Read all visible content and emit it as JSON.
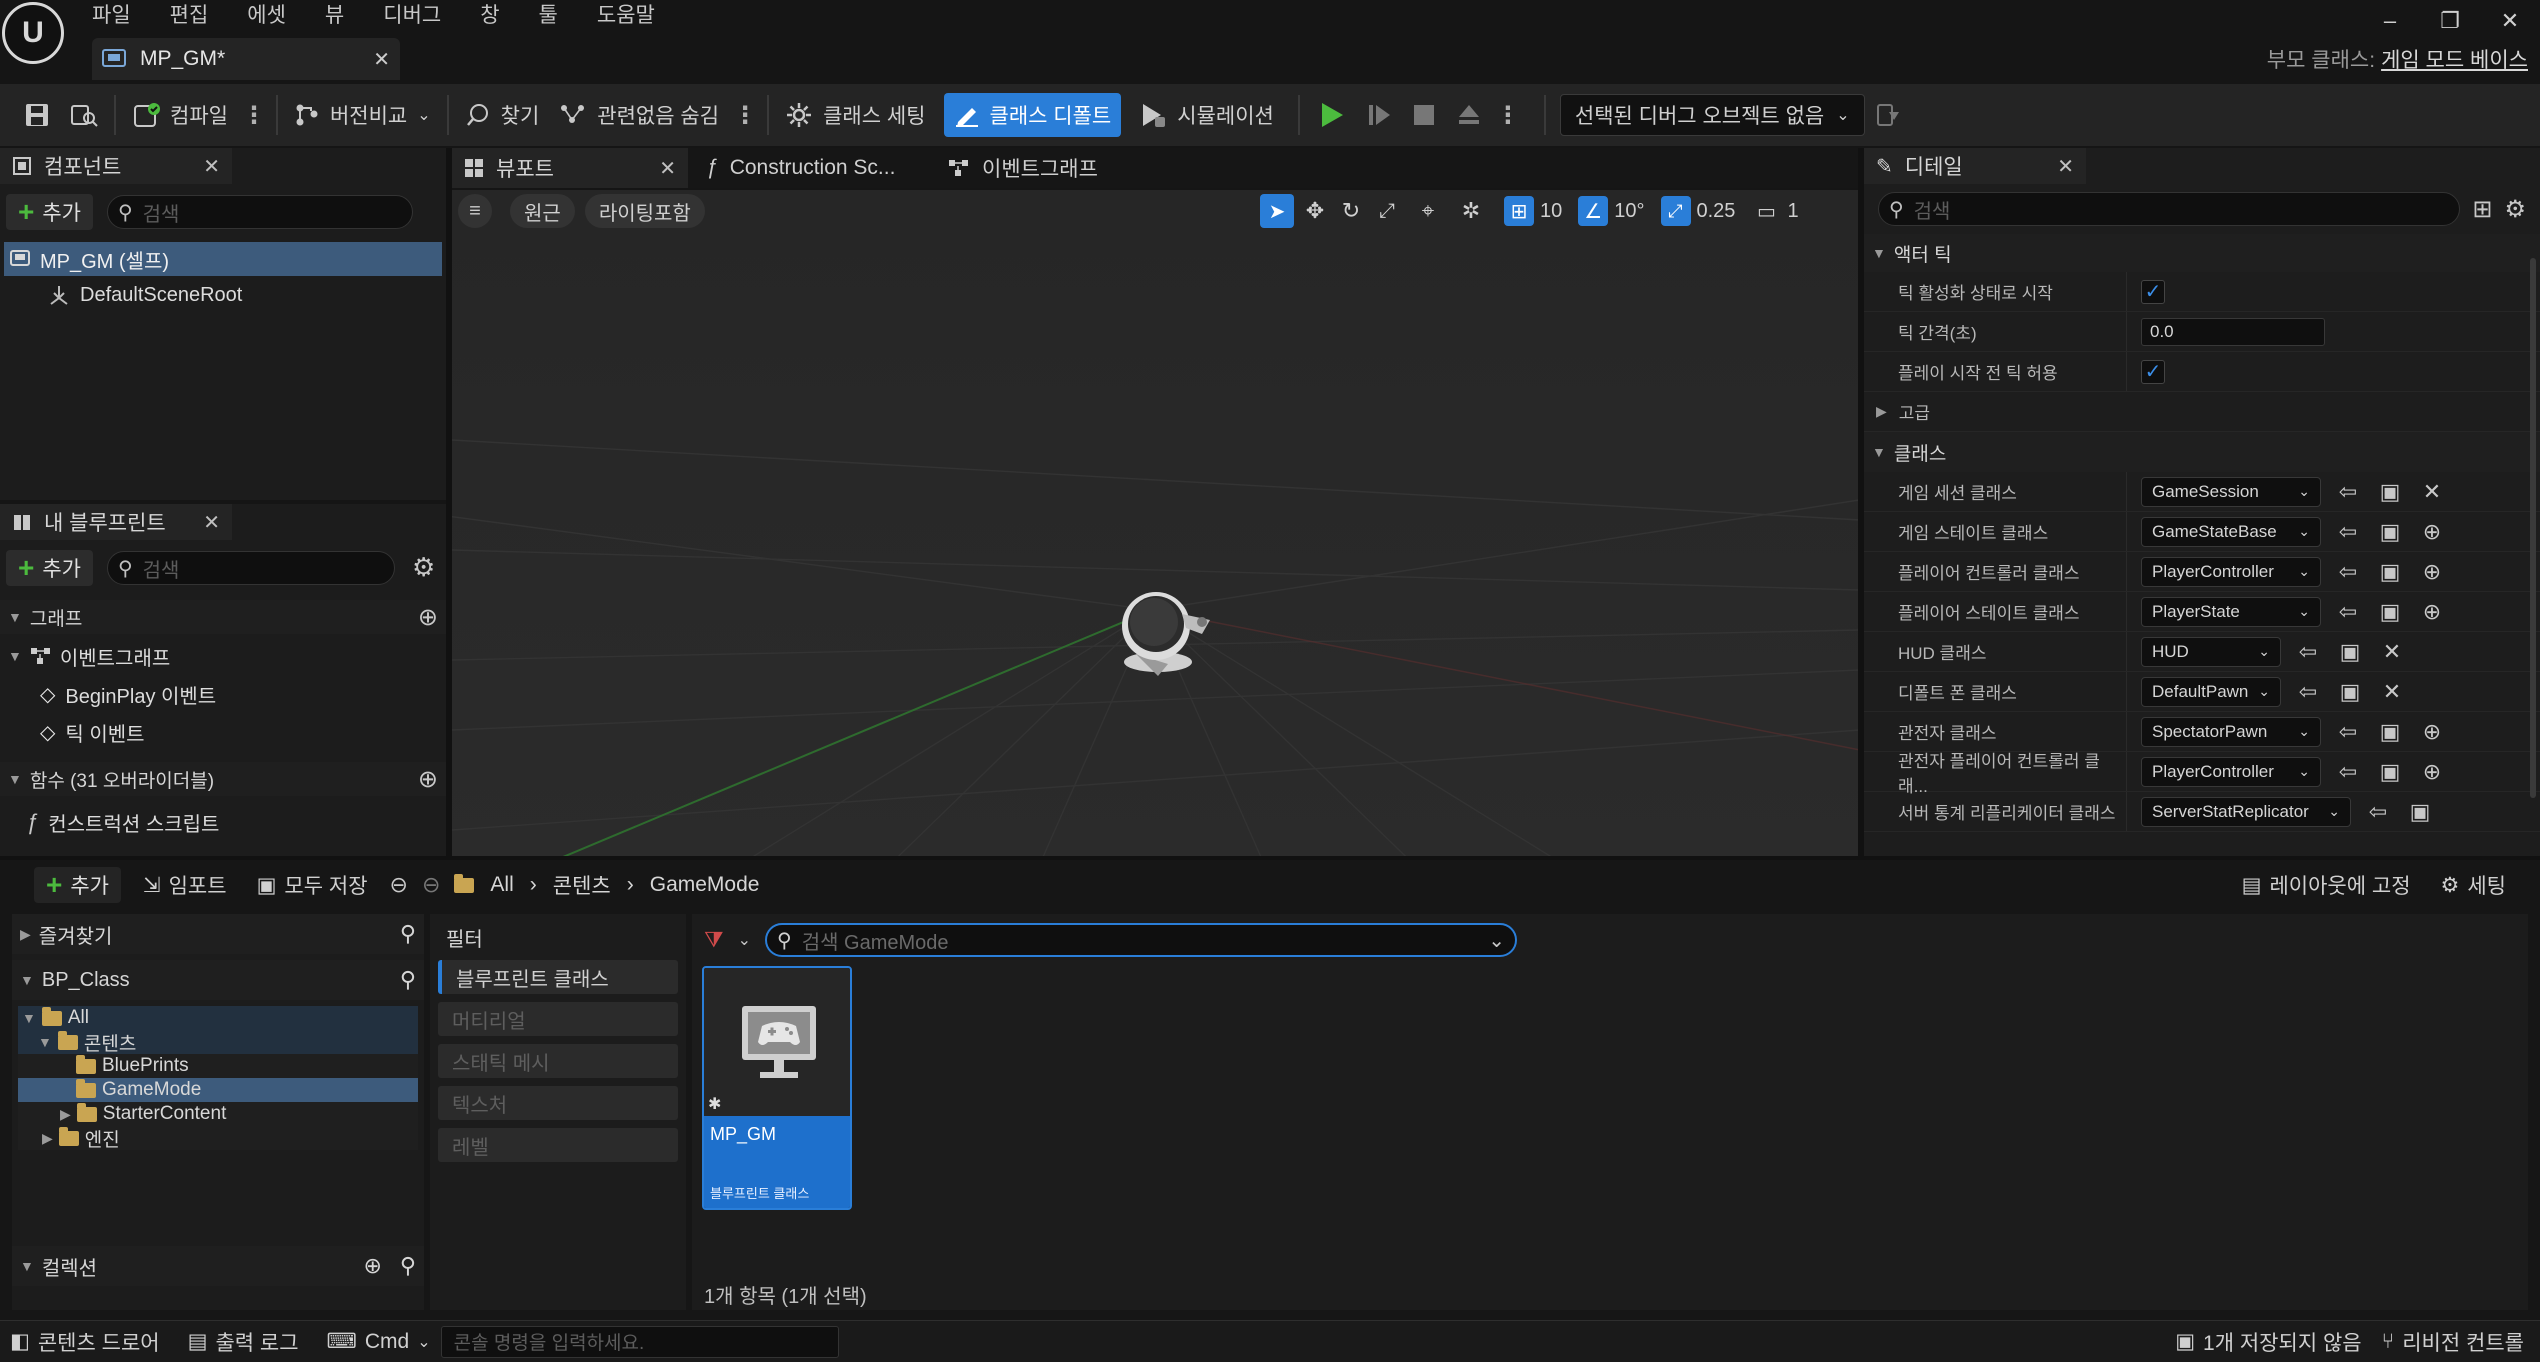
{
  "app": {
    "logo_text": "U",
    "menu": [
      "파일",
      "편집",
      "에셋",
      "뷰",
      "디버그",
      "창",
      "툴",
      "도움말"
    ],
    "doc_tab": "MP_GM*",
    "parent_class_label": "부모 클래스:",
    "parent_class_value": "게임 모드 베이스",
    "window_controls": [
      "–",
      "❐",
      "✕"
    ]
  },
  "toolbar": {
    "compile": "컴파일",
    "diff": "버전비교",
    "find": "찾기",
    "hide_unrelated": "관련없음 숨김",
    "class_settings": "클래스 세팅",
    "class_defaults": "클래스 디폴트",
    "simulation": "시뮬레이션",
    "debug_select": "선택된 디버그 오브젝트 없음"
  },
  "components": {
    "tab": "컴포넌트",
    "add": "추가",
    "search_placeholder": "검색",
    "items": [
      "MP_GM (셀프)",
      "DefaultSceneRoot"
    ]
  },
  "my_blueprint": {
    "tab": "내 블루프린트",
    "add": "추가",
    "search_placeholder": "검색",
    "graphs_header": "그래프",
    "event_graph": "이벤트그래프",
    "events": [
      "BeginPlay 이벤트",
      "틱 이벤트"
    ],
    "functions_header": "함수 (31 오버라이더블)",
    "construction_script": "컨스트럭션 스크립트"
  },
  "viewport": {
    "tabs": [
      "뷰포트",
      "Construction Sc...",
      "이벤트그래프"
    ],
    "perspective": "원근",
    "lit": "라이팅포함",
    "grid_snap": "10",
    "rot_snap": "10°",
    "scale_snap": "0.25",
    "cam_speed": "1"
  },
  "details": {
    "tab": "디테일",
    "search_placeholder": "검색",
    "actor_tick_header": "액터 틱",
    "tick_rows": [
      {
        "label": "틱 활성화 상태로 시작",
        "type": "check"
      },
      {
        "label": "틱 간격(초)",
        "type": "num",
        "value": "0.0"
      },
      {
        "label": "플레이 시작 전 틱 허용",
        "type": "check"
      }
    ],
    "advanced": "고급",
    "classes_header": "클래스",
    "class_rows": [
      {
        "label": "게임 세션 클래스",
        "value": "GameSession",
        "action": "✕"
      },
      {
        "label": "게임 스테이트 클래스",
        "value": "GameStateBase",
        "action": "⊕"
      },
      {
        "label": "플레이어 컨트롤러 클래스",
        "value": "PlayerController",
        "action": "⊕"
      },
      {
        "label": "플레이어 스테이트 클래스",
        "value": "PlayerState",
        "action": "⊕"
      },
      {
        "label": "HUD 클래스",
        "value": "HUD",
        "action": "✕"
      },
      {
        "label": "디폴트 폰 클래스",
        "value": "DefaultPawn",
        "action": "✕"
      },
      {
        "label": "관전자 클래스",
        "value": "SpectatorPawn",
        "action": "⊕"
      },
      {
        "label": "관전자 플레이어 컨트롤러 클래...",
        "value": "PlayerController",
        "action": "⊕"
      },
      {
        "label": "서버 통계 리플리케이터 클래스",
        "value": "ServerStatReplicator",
        "action": ""
      }
    ]
  },
  "content_browser": {
    "add": "추가",
    "import": "임포트",
    "save_all": "모두 저장",
    "breadcrumb": [
      "All",
      "콘텐츠",
      "GameMode"
    ],
    "lock_layout": "레이아웃에 고정",
    "settings": "세팅",
    "favorites": "즐겨찾기",
    "bp_class": "BP_Class",
    "tree": [
      "All",
      "콘텐츠",
      "BluePrints",
      "GameMode",
      "StarterContent",
      "엔진"
    ],
    "collections": "컬렉션",
    "filter_header": "필터",
    "filters": [
      "블루프린트 클래스",
      "머티리얼",
      "스태틱 메시",
      "텍스처",
      "레벨"
    ],
    "search_placeholder": "검색 GameMode",
    "asset": {
      "name": "MP_GM",
      "type": "블루프린트 클래스"
    },
    "item_count": "1개 항목 (1개 선택)"
  },
  "statusbar": {
    "content_drawer": "콘텐츠 드로어",
    "output_log": "출력 로그",
    "cmd": "Cmd",
    "console_placeholder": "콘솔 명령을 입력하세요.",
    "unsaved": "1개 저장되지 않음",
    "revision": "리비전 컨트롤"
  },
  "colors": {
    "accent": "#2a7ed8",
    "add_green": "#4cbb3e",
    "play_green": "#4cbb3e",
    "folder": "#c9a552"
  }
}
